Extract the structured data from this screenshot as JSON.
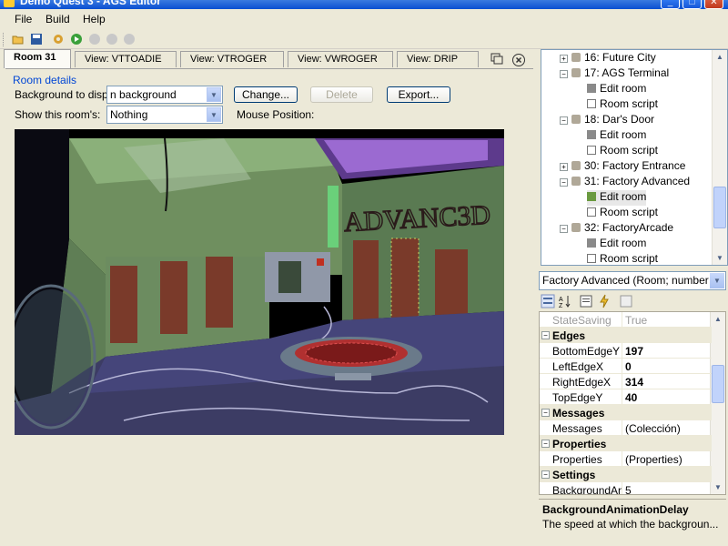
{
  "window": {
    "title": "Demo Quest 3 - AGS Editor"
  },
  "menu": [
    {
      "label": "File"
    },
    {
      "label": "Build"
    },
    {
      "label": "Help"
    }
  ],
  "toolbar": {
    "icons": [
      "open-folder-icon",
      "save-icon",
      "settings-gear-icon",
      "run-icon",
      "pause-icon",
      "stop-icon",
      "step-icon"
    ]
  },
  "tabs": [
    {
      "label": "Room 31",
      "active": true
    },
    {
      "label": "View: VTTOADIE",
      "active": false
    },
    {
      "label": "View: VTROGER",
      "active": false
    },
    {
      "label": "View: VWROGER",
      "active": false
    },
    {
      "label": "View: DRIP",
      "active": false
    }
  ],
  "room": {
    "group_label": "Room details",
    "background_label": "Background to display:",
    "background_value": "n background",
    "change_label": "Change...",
    "delete_label": "Delete",
    "export_label": "Export...",
    "show_label": "Show this room's:",
    "show_value": "Nothing",
    "mouse_label": "Mouse Position:",
    "wall_text": "ADVANC3D"
  },
  "tree": {
    "items": [
      {
        "label": "16: Future City",
        "kind": "room",
        "level": 0
      },
      {
        "label": "17: AGS Terminal",
        "kind": "room",
        "level": 0
      },
      {
        "label": "Edit room",
        "kind": "edit",
        "level": 1
      },
      {
        "label": "Room script",
        "kind": "script",
        "level": 1
      },
      {
        "label": "18: Dar's Door",
        "kind": "room",
        "level": 0
      },
      {
        "label": "Edit room",
        "kind": "edit",
        "level": 1
      },
      {
        "label": "Room script",
        "kind": "script",
        "level": 1
      },
      {
        "label": "30: Factory Entrance",
        "kind": "room",
        "level": 0
      },
      {
        "label": "31: Factory Advanced",
        "kind": "room",
        "level": 0
      },
      {
        "label": "Edit room",
        "kind": "edit",
        "level": 1,
        "selected": true
      },
      {
        "label": "Room script",
        "kind": "script",
        "level": 1
      },
      {
        "label": "32: FactoryArcade",
        "kind": "room",
        "level": 0
      },
      {
        "label": "Edit room",
        "kind": "edit",
        "level": 1
      },
      {
        "label": "Room script",
        "kind": "script",
        "level": 1
      }
    ]
  },
  "props": {
    "object_select": "Factory Advanced (Room; number",
    "rows": [
      {
        "type": "prop",
        "name": "StateSaving",
        "value": "True",
        "dim": true
      },
      {
        "type": "cat",
        "name": "Edges"
      },
      {
        "type": "prop",
        "name": "BottomEdgeY",
        "value": "197",
        "bold": true
      },
      {
        "type": "prop",
        "name": "LeftEdgeX",
        "value": "0",
        "bold": true
      },
      {
        "type": "prop",
        "name": "RightEdgeX",
        "value": "314",
        "bold": true
      },
      {
        "type": "prop",
        "name": "TopEdgeY",
        "value": "40",
        "bold": true
      },
      {
        "type": "cat",
        "name": "Messages"
      },
      {
        "type": "prop",
        "name": "Messages",
        "value": "(Colección)"
      },
      {
        "type": "cat",
        "name": "Properties"
      },
      {
        "type": "prop",
        "name": "Properties",
        "value": "(Properties)"
      },
      {
        "type": "cat",
        "name": "Settings"
      },
      {
        "type": "prop",
        "name": "BackgroundAn",
        "value": "5"
      }
    ],
    "desc_title": "BackgroundAnimationDelay",
    "desc_text": "The speed at which the backgroun..."
  },
  "colors": {
    "accent": "#0a4fd1",
    "selection": "#316ac5",
    "room_floor": "#3c3c64",
    "room_wall": "#7fa070"
  }
}
